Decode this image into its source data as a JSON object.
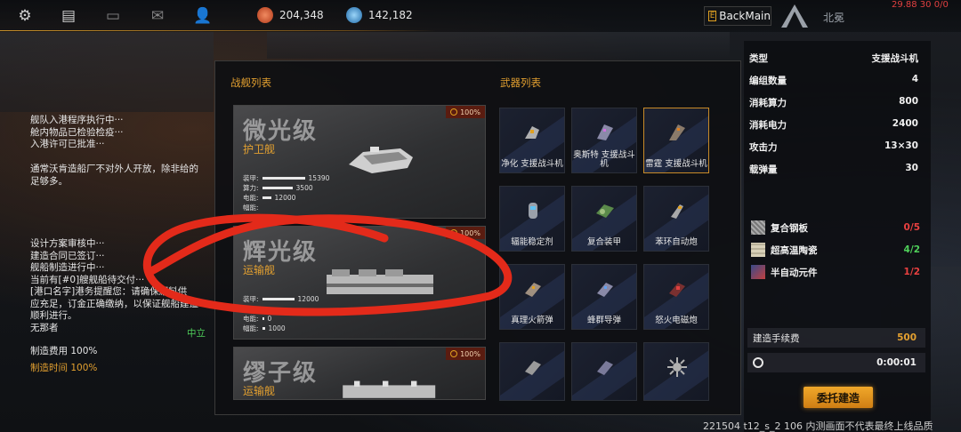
{
  "topbar": {
    "icons": [
      "gear-icon",
      "chat-icon",
      "mail-icon",
      "message-icon",
      "friends-icon"
    ],
    "resource_1": {
      "value": "204,348",
      "color": "#e26a3a"
    },
    "resource_2": {
      "value": "142,182",
      "color": "#4aa4e0"
    },
    "back_label": "BackMain",
    "region": "北冕",
    "fps": "29.88 30 0/0"
  },
  "log": {
    "block1": [
      "舰队入港程序执行中···",
      "舱内物品已检验检疫···",
      "入港许可已批准···"
    ],
    "notice": [
      "通常沃肯造船厂不对外人开放，除非给的",
      "足够多。"
    ],
    "block2": [
      "设计方案审核中···",
      "建造合同已签订···",
      "舰船制造进行中···",
      "当前有[#0]艘舰船待交付···",
      "[港口名字]港务提醒您：请确保原料供",
      "应充足，订金正确缴纳，以保证舰船建造",
      "顺利进行。",
      "无那者"
    ],
    "neutral": "中立",
    "cost": "制造费用 100%",
    "time": "制造时间 100%"
  },
  "ships_title": "战舰列表",
  "weapons_title": "武器列表",
  "ships": [
    {
      "name": "微光级",
      "type": "护卫舰",
      "badge": "100%",
      "stats": [
        {
          "label": "装甲:",
          "value": "15390"
        },
        {
          "label": "算力:",
          "value": "3500"
        },
        {
          "label": "电能:",
          "value": "12000"
        },
        {
          "label": "幅能:",
          "value": ""
        }
      ]
    },
    {
      "name": "辉光级",
      "type": "运输舰",
      "badge": "100%",
      "stats": [
        {
          "label": "装甲:",
          "value": "12000"
        },
        {
          "label": "电能:",
          "value": "0"
        },
        {
          "label": "幅能:",
          "value": "1000"
        }
      ]
    },
    {
      "name": "缪子级",
      "type": "运输舰",
      "badge": "100%",
      "stats": []
    }
  ],
  "weapons": [
    {
      "label": "净化 支援战斗机"
    },
    {
      "label": "奥斯特 支援战斗机"
    },
    {
      "label": "雷霆 支援战斗机"
    },
    {
      "label": "辐能稳定剂"
    },
    {
      "label": "复合装甲"
    },
    {
      "label": "苯环自动炮"
    },
    {
      "label": "真理火箭弹"
    },
    {
      "label": "蜂群导弹"
    },
    {
      "label": "怒火电磁炮"
    },
    {
      "label": ""
    },
    {
      "label": ""
    },
    {
      "label": ""
    }
  ],
  "info": {
    "rows": [
      {
        "k": "类型",
        "v": "支援战斗机"
      },
      {
        "k": "编组数量",
        "v": "4"
      },
      {
        "k": "消耗算力",
        "v": "800"
      },
      {
        "k": "消耗电力",
        "v": "2400"
      },
      {
        "k": "攻击力",
        "v": "13×30"
      },
      {
        "k": "载弹量",
        "v": "30"
      }
    ],
    "materials": [
      {
        "name": "复合钢板",
        "val": "0/5",
        "color": "#e84040"
      },
      {
        "name": "超高温陶瓷",
        "val": "4/2",
        "color": "#4fd05a"
      },
      {
        "name": "半自动元件",
        "val": "1/2",
        "color": "#e84040"
      }
    ],
    "fee_label": "建造手续费",
    "fee_value": "500",
    "timer": "0:00:01",
    "commission": "委托建造"
  },
  "footer": "221504 t12_s_2 106 内测画面不代表最终上线品质"
}
